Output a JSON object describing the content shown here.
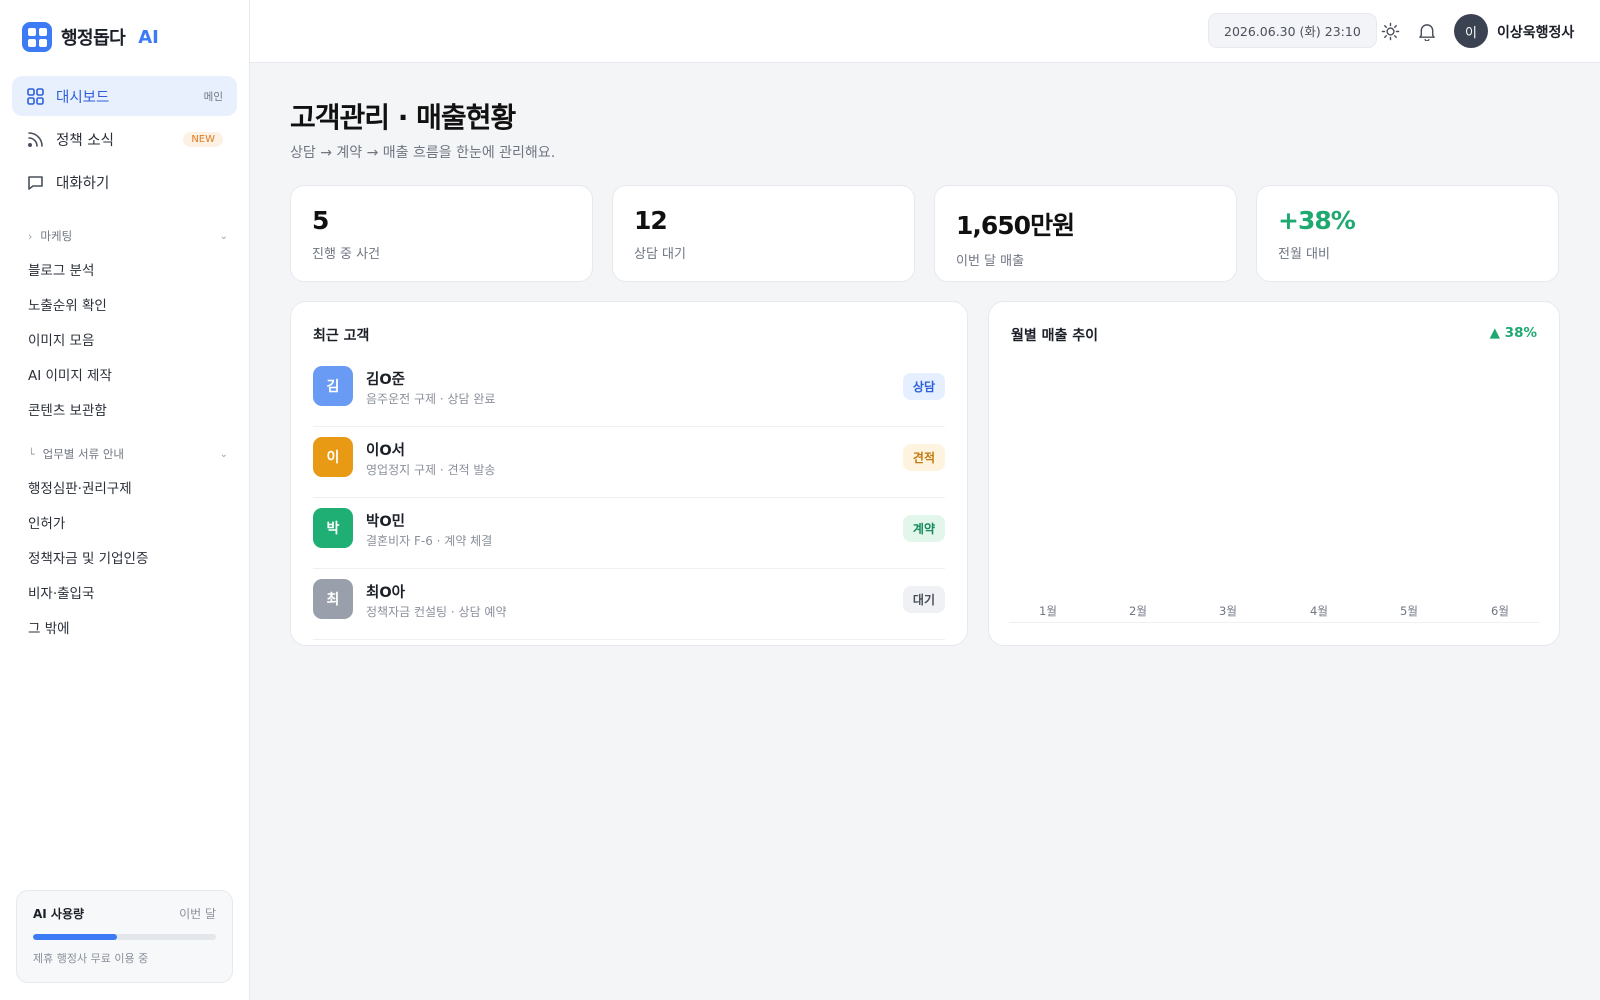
{
  "brand": {
    "name": "행정돕다",
    "accent": "AI",
    "accent_color": "#3d7af5",
    "logo_icon": "grid-icon"
  },
  "sidebar": {
    "nav": [
      {
        "label": "대시보드",
        "tag": "메인",
        "icon": "dashboard-grid-icon",
        "active": true
      },
      {
        "label": "정책 소식",
        "tag": "NEW",
        "icon": "rss-icon",
        "active": false
      },
      {
        "label": "대화하기",
        "tag": "",
        "icon": "chat-bubble-icon",
        "active": false
      }
    ],
    "sections": [
      {
        "title": "마케팅",
        "marker": "›",
        "items": [
          "블로그 분석",
          "노출순위 확인",
          "이미지 모음",
          "AI 이미지 제작",
          "콘텐츠 보관함"
        ]
      },
      {
        "title": "업무별 서류 안내",
        "marker": "└",
        "items": [
          "행정심판·권리구제",
          "인허가",
          "정책자금 및 기업인증",
          "비자·출입국",
          "그 밖에"
        ]
      }
    ],
    "usage": {
      "title": "AI 사용량",
      "period": "이번 달",
      "progress": 0.46,
      "note": "제휴 행정사 무료 이용 중"
    }
  },
  "header": {
    "datetime": "2026.06.30 (화) 23:10",
    "icons": [
      "sun-icon",
      "bell-icon"
    ],
    "user": {
      "avatar_initial": "이",
      "name": "이상욱행정사"
    }
  },
  "main": {
    "title": "고객관리 · 매출현황",
    "subtitle": "상담 → 계약 → 매출 흐름을 한눈에 관리해요.",
    "stats": [
      {
        "value": "5",
        "label": "진행 중 사건",
        "color": "#111111"
      },
      {
        "value": "12",
        "label": "상담 대기",
        "color": "#111111"
      },
      {
        "value": "1,650만원",
        "label": "이번 달 매출",
        "color": "#111111"
      },
      {
        "value": "+38%",
        "label": "전월 대비",
        "color": "#1fa971"
      }
    ],
    "recent_customers": {
      "title": "최근 고객",
      "rows": [
        {
          "initial": "김",
          "name": "김O준",
          "desc": "음주운전 구제 · 상담 완료",
          "status": "상담",
          "avatar_color": "#6a9bf4",
          "badge_bg": "#e6efff",
          "badge_fg": "#2c5fd8"
        },
        {
          "initial": "이",
          "name": "이O서",
          "desc": "영업정지 구제 · 견적 발송",
          "status": "견적",
          "avatar_color": "#e89a14",
          "badge_bg": "#fdf3df",
          "badge_fg": "#c27a0e"
        },
        {
          "initial": "박",
          "name": "박O민",
          "desc": "결혼비자 F-6 · 계약 체결",
          "status": "계약",
          "avatar_color": "#1fae73",
          "badge_bg": "#e2f6ec",
          "badge_fg": "#168a5a"
        },
        {
          "initial": "최",
          "name": "최O아",
          "desc": "정책자금 컨설팅 · 상담 예약",
          "status": "대기",
          "avatar_color": "#9aa0ab",
          "badge_bg": "#f0f1f4",
          "badge_fg": "#4a505b"
        }
      ]
    },
    "monthly_chart": {
      "title": "월별 매출 추이",
      "peak": "▲ 38%",
      "months": [
        "1월",
        "2월",
        "3월",
        "4월",
        "5월",
        "6월"
      ]
    }
  }
}
